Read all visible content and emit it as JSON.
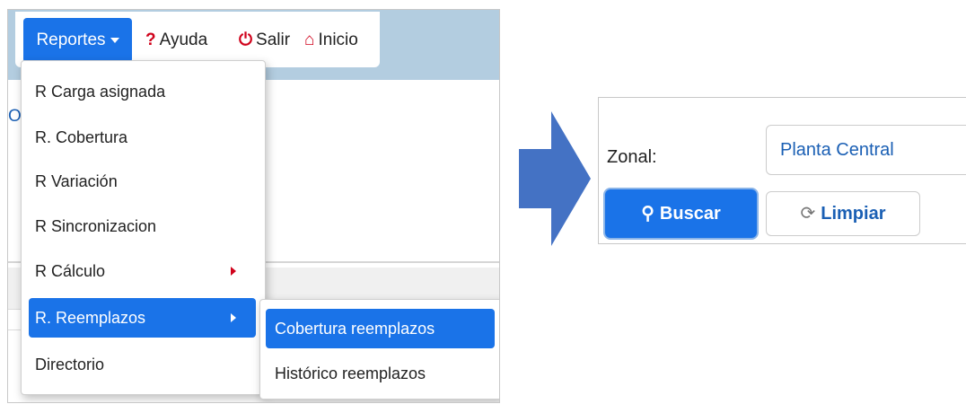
{
  "navbar": {
    "reportes_label": "Reportes",
    "help_label": "Ayuda",
    "exit_label": "Salir",
    "home_label": "Inicio"
  },
  "background": {
    "partial_text": "O"
  },
  "reportes_menu": {
    "items": [
      {
        "label": "R Carga asignada"
      },
      {
        "label": "R. Cobertura"
      },
      {
        "label": "R Variación"
      },
      {
        "label": "R Sincronizacion"
      },
      {
        "label": "R Cálculo"
      },
      {
        "label": "R. Reemplazos"
      },
      {
        "label": "Directorio"
      }
    ]
  },
  "reemplazos_submenu": {
    "items": [
      {
        "label": "Cobertura reemplazos"
      },
      {
        "label": "Histórico reemplazos"
      }
    ]
  },
  "filter_form": {
    "zonal_label": "Zonal:",
    "zonal_value": "Planta Central",
    "search_label": "Buscar",
    "clear_label": "Limpiar"
  },
  "icons": {
    "help": "question-mark-icon",
    "exit": "power-icon",
    "home": "home-icon",
    "search": "magnifier-icon",
    "clear": "refresh-icon",
    "submenu": "caret-right-icon"
  },
  "colors": {
    "primary": "#1a73e8",
    "header_band": "#b3cde0",
    "icon_red": "#d0021b",
    "arrow": "#4472c4",
    "link_blue": "#1a5fb4"
  }
}
